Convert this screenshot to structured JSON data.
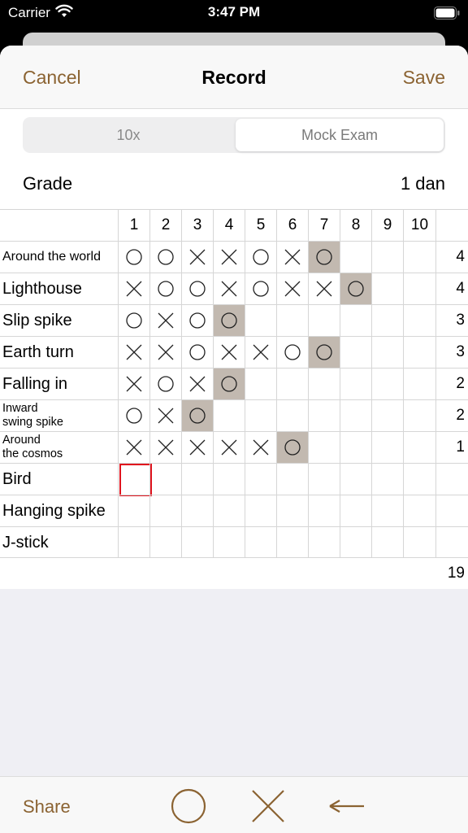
{
  "status": {
    "carrier": "Carrier",
    "time": "3:47 PM"
  },
  "nav": {
    "cancel": "Cancel",
    "title": "Record",
    "save": "Save"
  },
  "segments": [
    "10x",
    "Mock Exam"
  ],
  "grade": {
    "label": "Grade",
    "value": "1 dan"
  },
  "columns": [
    "1",
    "2",
    "3",
    "4",
    "5",
    "6",
    "7",
    "8",
    "9",
    "10"
  ],
  "rows": [
    {
      "name": "Around the world",
      "size": "small",
      "marks": [
        "o",
        "o",
        "x",
        "x",
        "o",
        "x",
        "h"
      ],
      "total": "4"
    },
    {
      "name": "Lighthouse",
      "size": "",
      "marks": [
        "x",
        "o",
        "o",
        "x",
        "o",
        "x",
        "x",
        "h"
      ],
      "total": "4"
    },
    {
      "name": "Slip spike",
      "size": "",
      "marks": [
        "o",
        "x",
        "o",
        "h"
      ],
      "total": "3"
    },
    {
      "name": "Earth turn",
      "size": "",
      "marks": [
        "x",
        "x",
        "o",
        "x",
        "x",
        "o",
        "h"
      ],
      "total": "3"
    },
    {
      "name": "Falling in",
      "size": "",
      "marks": [
        "x",
        "o",
        "x",
        "h"
      ],
      "total": "2"
    },
    {
      "name": "Inward\nswing spike",
      "size": "xs",
      "marks": [
        "o",
        "x",
        "h"
      ],
      "total": "2"
    },
    {
      "name": "Around\nthe cosmos",
      "size": "xs",
      "marks": [
        "x",
        "x",
        "x",
        "x",
        "x",
        "h"
      ],
      "total": "1"
    },
    {
      "name": "Bird",
      "size": "",
      "marks": [
        "sel"
      ],
      "total": ""
    },
    {
      "name": "Hanging spike",
      "size": "",
      "marks": [],
      "total": ""
    },
    {
      "name": "J-stick",
      "size": "",
      "marks": [],
      "total": ""
    }
  ],
  "grand_total": "19",
  "toolbar": {
    "share": "Share",
    "icons": [
      "circle-icon",
      "cross-icon",
      "back-arrow-icon"
    ]
  }
}
